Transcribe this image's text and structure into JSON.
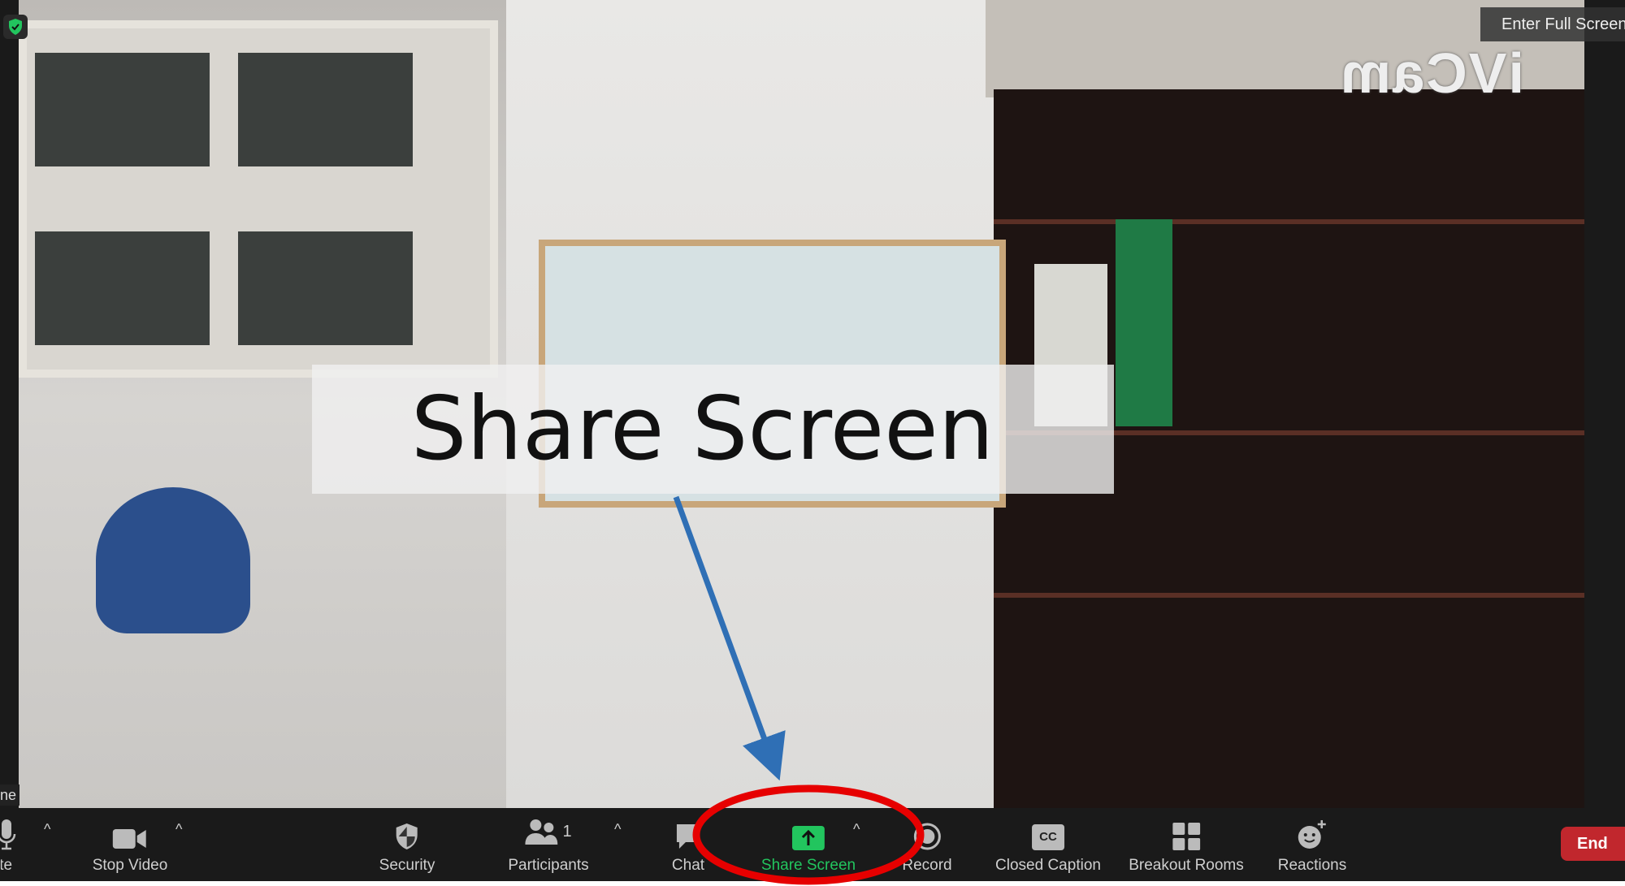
{
  "video": {
    "watermark": "iVCam",
    "overlay_title": "Share Screen",
    "participant_name_partial": "ne",
    "fullscreen_label": "Enter Full Screen"
  },
  "toolbar": {
    "mute": "Mute",
    "stop_video": "Stop Video",
    "security": "Security",
    "participants": "Participants",
    "participant_count": "1",
    "chat": "Chat",
    "share_screen": "Share Screen",
    "record": "Record",
    "closed_caption": "Closed Caption",
    "cc_glyph": "CC",
    "breakout_rooms": "Breakout Rooms",
    "reactions": "Reactions",
    "end": "End"
  },
  "colors": {
    "share_screen_accent": "#22c55e",
    "end_button": "#c1272d",
    "annotation_ellipse": "#e60000",
    "annotation_arrow": "#2f6fb5"
  }
}
